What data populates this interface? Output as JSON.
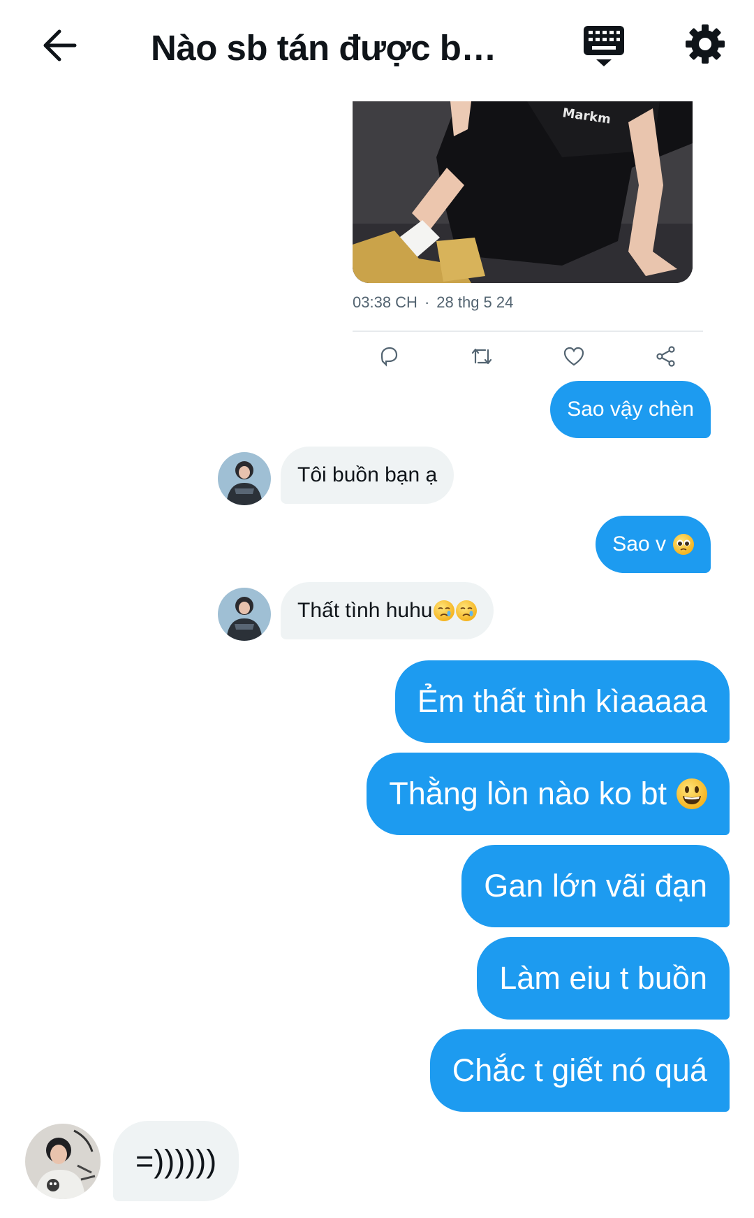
{
  "header": {
    "title": "Nào sb tán được bg t…"
  },
  "tweet": {
    "time": "03:38 CH",
    "date": "28 thg 5 24",
    "shirt_text": "Markm"
  },
  "messages": [
    {
      "side": "sent",
      "text": "Sao vậy chèn"
    },
    {
      "side": "received",
      "text": "Tôi buồn bạn ạ"
    },
    {
      "side": "sent",
      "text": "Sao v",
      "emoji": "pleading-face"
    },
    {
      "side": "received",
      "text": "Thất tình huhu",
      "emoji": "crying-face x2"
    },
    {
      "side": "sent",
      "text": "Ẻm thất tình kìaaaaa"
    },
    {
      "side": "sent",
      "text": "Thằng lòn nào ko bt",
      "emoji": "grinning-face"
    },
    {
      "side": "sent",
      "text": "Gan lớn vãi đạn"
    },
    {
      "side": "sent",
      "text": "Làm eiu t buồn"
    },
    {
      "side": "sent",
      "text": "Chắc t giết nó quá"
    },
    {
      "side": "received",
      "text": "=))))))"
    }
  ],
  "colors": {
    "accent": "#1d9bf0",
    "received_bubble": "#eff3f4",
    "text": "#0f1419",
    "muted": "#536471"
  },
  "icons": [
    "back-arrow-icon",
    "keyboard-icon",
    "settings-gear-icon",
    "reply-icon",
    "retweet-icon",
    "like-heart-icon",
    "share-icon"
  ]
}
